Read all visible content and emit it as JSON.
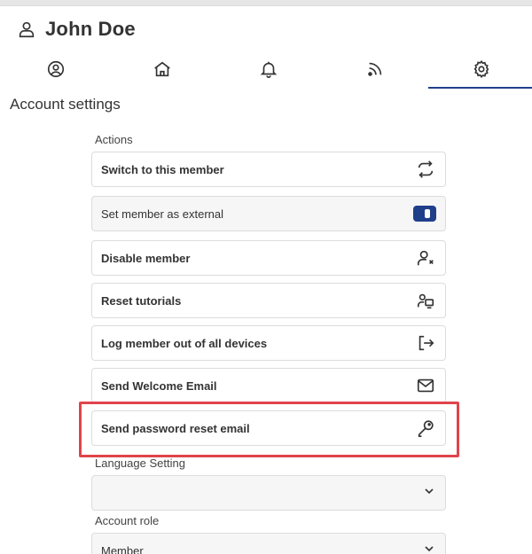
{
  "header": {
    "user_name": "John Doe",
    "icon": "user-icon"
  },
  "tabs": [
    {
      "name": "profile",
      "icon": "user-circle-icon",
      "active": false
    },
    {
      "name": "home",
      "icon": "home-icon",
      "active": false
    },
    {
      "name": "notifications",
      "icon": "bell-icon",
      "active": false
    },
    {
      "name": "feed",
      "icon": "rss-icon",
      "active": false
    },
    {
      "name": "settings",
      "icon": "gear-icon",
      "active": true
    }
  ],
  "section_title": "Account settings",
  "actions": {
    "label": "Actions",
    "items": [
      {
        "label": "Switch to this member",
        "icon": "switch-arrows-icon"
      },
      {
        "label": "Set member as external",
        "icon": "toggle-switch"
      },
      {
        "label": "Disable member",
        "icon": "user-remove-icon"
      },
      {
        "label": "Reset tutorials",
        "icon": "tutorial-screen-icon"
      },
      {
        "label": "Log member out of all devices",
        "icon": "logout-icon"
      },
      {
        "label": "Send Welcome Email",
        "icon": "mail-icon"
      },
      {
        "label": "Send password reset email",
        "icon": "key-icon"
      }
    ]
  },
  "language": {
    "label": "Language Setting",
    "value": ""
  },
  "account_role": {
    "label": "Account role",
    "value": "Member"
  },
  "colors": {
    "accent": "#1f3f8a",
    "highlight": "#e0444b",
    "border": "#dcdcdc"
  }
}
